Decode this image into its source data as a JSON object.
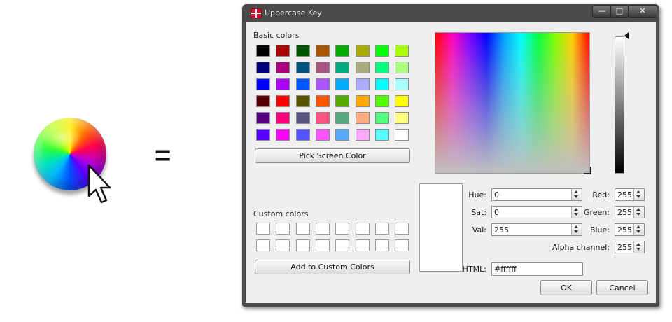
{
  "illustration": {
    "equals_sign": "="
  },
  "window": {
    "title": "Uppercase Key",
    "buttons": {
      "minimize": "—",
      "maximize": "□",
      "close": "✕"
    }
  },
  "basic_colors": {
    "label": "Basic colors",
    "swatches": [
      [
        "#000000",
        "#aa0000",
        "#005500",
        "#aa5500",
        "#00aa00",
        "#aaaa00",
        "#00ff00",
        "#aaff00"
      ],
      [
        "#00007f",
        "#aa007f",
        "#00557f",
        "#aa557f",
        "#00aa7f",
        "#aaaa7f",
        "#00ff7f",
        "#aaff7f"
      ],
      [
        "#0000ff",
        "#aa00ff",
        "#0055ff",
        "#aa55ff",
        "#00aaff",
        "#aaaaff",
        "#00ffff",
        "#aaffff"
      ],
      [
        "#550000",
        "#ff0000",
        "#555500",
        "#ff5500",
        "#55aa00",
        "#ffaa00",
        "#55ff00",
        "#ffff00"
      ],
      [
        "#55007f",
        "#ff007f",
        "#55557f",
        "#ff557f",
        "#55aa7f",
        "#ffaa7f",
        "#55ff7f",
        "#ffff7f"
      ],
      [
        "#5500ff",
        "#ff00ff",
        "#5555ff",
        "#ff55ff",
        "#55aaff",
        "#ffaaff",
        "#55ffff",
        "#ffffff"
      ]
    ]
  },
  "pick_screen_color": "Pick Screen Color",
  "custom_colors": {
    "label": "Custom colors",
    "count": 16
  },
  "add_to_custom": "Add to Custom Colors",
  "fields": {
    "hue": {
      "label": "Hue:",
      "value": "0"
    },
    "sat": {
      "label": "Sat:",
      "value": "0"
    },
    "val": {
      "label": "Val:",
      "value": "255"
    },
    "red": {
      "label": "Red:",
      "value": "255"
    },
    "green": {
      "label": "Green:",
      "value": "255"
    },
    "blue": {
      "label": "Blue:",
      "value": "255"
    },
    "alpha": {
      "label": "Alpha channel:",
      "value": "255"
    },
    "html": {
      "label": "HTML:",
      "value": "#ffffff"
    }
  },
  "preview_color": "#ffffff",
  "ok_button": "OK",
  "cancel_button": "Cancel"
}
